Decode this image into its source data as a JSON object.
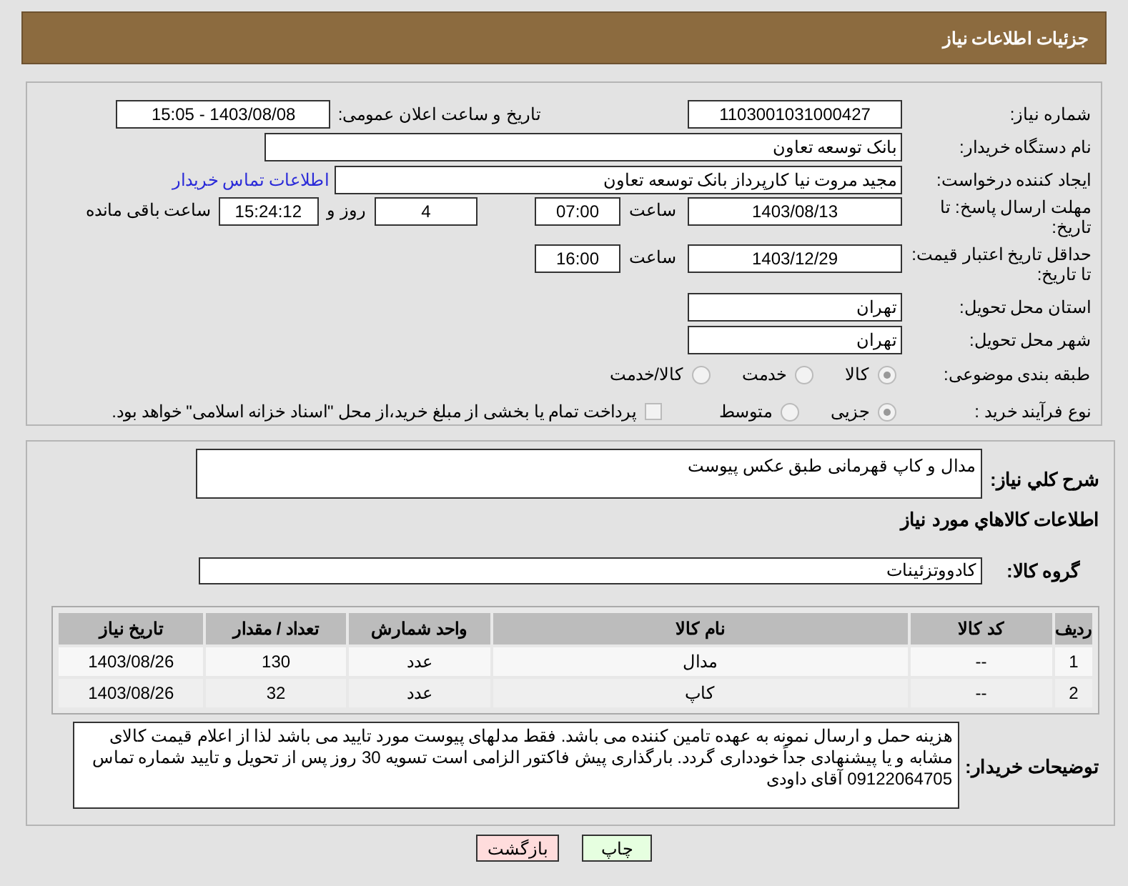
{
  "header": {
    "title": "جزئیات اطلاعات نیاز"
  },
  "need_number": {
    "label": "شماره نیاز:",
    "value": "1103001031000427"
  },
  "announce": {
    "label": "تاریخ و ساعت اعلان عمومی:",
    "value": "1403/08/08 - 15:05"
  },
  "buyer_org": {
    "label": "نام دستگاه خریدار:",
    "value": "بانک توسعه تعاون"
  },
  "requester": {
    "label": "ایجاد کننده درخواست:",
    "value": "مجید مروت نیا کارپرداز بانک توسعه تعاون",
    "link": "اطلاعات تماس خریدار"
  },
  "reply_deadline": {
    "label": "مهلت ارسال پاسخ: تا تاریخ:",
    "date": "1403/08/13",
    "time_label": "ساعت",
    "time": "07:00",
    "days": "4",
    "days_label": "روز و",
    "remaining": "15:24:12",
    "remaining_label": "ساعت باقی مانده"
  },
  "price_validity": {
    "label": "حداقل تاریخ اعتبار قیمت: تا تاریخ:",
    "date": "1403/12/29",
    "time_label": "ساعت",
    "time": "16:00"
  },
  "province": {
    "label": "استان محل تحویل:",
    "value": "تهران"
  },
  "city": {
    "label": "شهر محل تحویل:",
    "value": "تهران"
  },
  "category": {
    "label": "طبقه بندی موضوعی:",
    "options": [
      {
        "label": "کالا",
        "selected": true
      },
      {
        "label": "خدمت",
        "selected": false
      },
      {
        "label": "کالا/خدمت",
        "selected": false
      }
    ]
  },
  "process": {
    "label": "نوع فرآیند خرید :",
    "options": [
      {
        "label": "جزیی",
        "selected": true
      },
      {
        "label": "متوسط",
        "selected": false
      }
    ],
    "payment": {
      "label": "پرداخت تمام یا بخشی از مبلغ خرید،از محل \"اسناد خزانه اسلامی\" خواهد بود.",
      "checked": false
    }
  },
  "description": {
    "label": "شرح کلي نياز:",
    "value": "مدال و کاپ قهرمانی طبق عکس پیوست"
  },
  "goods_title": "اطلاعات کالاهاي مورد نياز",
  "goods_group": {
    "label": "گروه کالا:",
    "value": "کادووتزئینات"
  },
  "table": {
    "columns": [
      "ردیف",
      "کد کالا",
      "نام کالا",
      "واحد شمارش",
      "تعداد / مقدار",
      "تاریخ نیاز"
    ],
    "rows": [
      [
        "1",
        "--",
        "مدال",
        "عدد",
        "130",
        "1403/08/26"
      ],
      [
        "2",
        "--",
        "کاپ",
        "عدد",
        "32",
        "1403/08/26"
      ]
    ]
  },
  "buyer_notes": {
    "label": "توضیحات خریدار:",
    "value": "هزینه حمل و ارسال نمونه به عهده تامین کننده می باشد. فقط مدلهای پیوست مورد تایید می باشد لذا از اعلام قیمت کالای مشابه و یا پیشنهادی جداً خودداری گردد. بارگذاری پیش فاکتور الزامی است تسویه 30 روز پس از تحویل و تایید شماره تماس 09122064705 آقای داودی"
  },
  "buttons": [
    {
      "label": "چاپ",
      "kind": "print"
    },
    {
      "label": "بازگشت",
      "kind": "back"
    }
  ]
}
